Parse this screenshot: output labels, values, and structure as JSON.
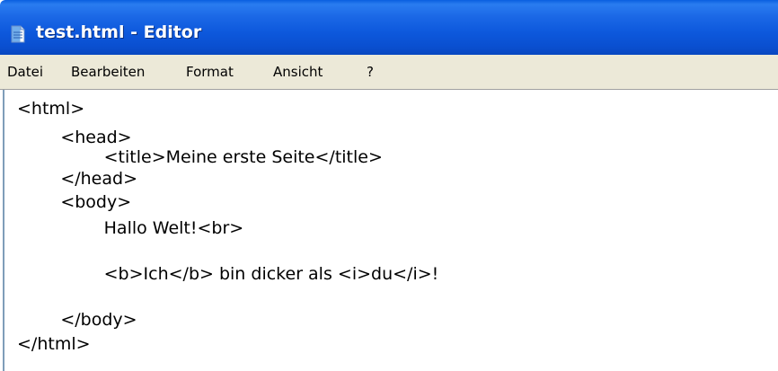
{
  "window": {
    "title": "test.html - Editor",
    "icon": "notepad-icon"
  },
  "menubar": {
    "items": [
      "Datei",
      "Bearbeiten",
      "Format",
      "Ansicht",
      "?"
    ]
  },
  "editor": {
    "lines": [
      "<html>",
      "        <head>",
      "                <title>Meine erste Seite</title>",
      "        </head>",
      "        <body>",
      "                Hallo Welt!<br>",
      "",
      "                <b>Ich</b> bin dicker als <i>du</i>!",
      "",
      "        </body>",
      "</html>"
    ]
  },
  "colors": {
    "titlebar": "#0a58dc",
    "menubar": "#ece9d8",
    "editor_bg": "#ffffff"
  }
}
